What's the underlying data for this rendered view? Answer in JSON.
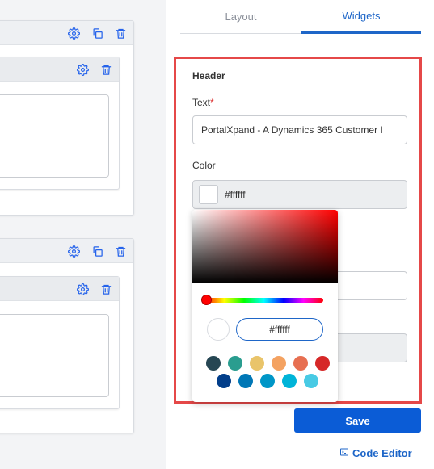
{
  "tabs": [
    {
      "label": "Layout"
    },
    {
      "label": "Widgets"
    }
  ],
  "header": {
    "section_title": "Header",
    "text_label": "Text",
    "text_required_mark": "*",
    "text_value": "PortalXpand - A Dynamics 365 Customer I",
    "color_label": "Color",
    "color_value": "#ffffff"
  },
  "picker": {
    "hex_value": "#ffffff",
    "base_hue": "#ff0000",
    "swatches": [
      "#264653",
      "#2a9d8f",
      "#e9c46a",
      "#f4a261",
      "#e76f51",
      "#d62828",
      "#023e8a",
      "#0077b6",
      "#0096c7",
      "#00b4d8",
      "#48cae4"
    ]
  },
  "actions": {
    "save_label": "Save",
    "code_editor_label": "Code Editor"
  },
  "colors": {
    "accent": "#1e66c8",
    "save_button": "#0b5cd6",
    "highlight_border": "#e54848"
  }
}
